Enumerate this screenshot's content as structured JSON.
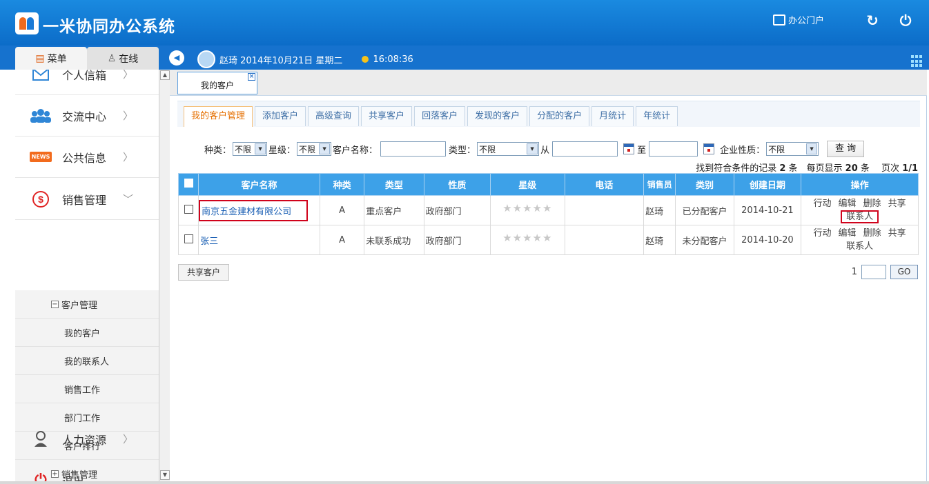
{
  "app": {
    "title": "一米协同办公系统",
    "portal": "办公门户"
  },
  "sidebar_tabs": {
    "menu": "菜单",
    "online": "在线"
  },
  "user": {
    "info": "赵琦 2014年10月21日 星期二",
    "time": "16:08:36"
  },
  "menu": [
    {
      "label": "个人信箱",
      "icon": "mail-icon"
    },
    {
      "label": "交流中心",
      "icon": "people-icon"
    },
    {
      "label": "公共信息",
      "icon": "news-icon",
      "badge": "NEWS"
    },
    {
      "label": "销售管理",
      "icon": "dollar-icon"
    },
    {
      "label": "人力资源",
      "icon": "person-icon"
    },
    {
      "label": "退出",
      "icon": "power-icon"
    }
  ],
  "submenu": {
    "group": "客户管理",
    "items": [
      "我的客户",
      "我的联系人",
      "销售工作",
      "部门工作",
      "客户排行"
    ],
    "group2": "销售管理"
  },
  "doc_tab": "我的客户",
  "subtabs": [
    "我的客户管理",
    "添加客户",
    "高级查询",
    "共享客户",
    "回落客户",
    "发现的客户",
    "分配的客户",
    "月统计",
    "年统计"
  ],
  "search": {
    "kind_label": "种类：",
    "kind": "不限",
    "star_label": "星级：",
    "star": "不限",
    "name_label": "客户名称：",
    "type_label": "类型：",
    "type": "不限",
    "from_label": "从",
    "to_label": "至",
    "nature_label": "企业性质：",
    "nature": "不限",
    "button": "查 询"
  },
  "summary": {
    "pre": "找到符合条件的记录 ",
    "count": "2",
    "mid": " 条　每页显示 ",
    "per": "20",
    "mid2": " 条　 页次 ",
    "page": "1/1"
  },
  "table": {
    "headers": [
      "客户名称",
      "种类",
      "类型",
      "性质",
      "星级",
      "电话",
      "销售员",
      "类别",
      "创建日期",
      "操作"
    ],
    "rows": [
      {
        "name": "南京五金建材有限公司",
        "kind": "A",
        "type": "重点客户",
        "nature": "政府部门",
        "stars": 0,
        "phone": "",
        "sales": "赵琦",
        "category": "已分配客户",
        "date": "2014-10-21"
      },
      {
        "name": "张三",
        "kind": "A",
        "type": "未联系成功",
        "nature": "政府部门",
        "stars": 0,
        "phone": "",
        "sales": "赵琦",
        "category": "未分配客户",
        "date": "2014-10-20"
      }
    ],
    "ops": {
      "action": "行动",
      "edit": "编辑",
      "delete": "删除",
      "share": "共享",
      "contact": "联系人"
    }
  },
  "share_button": "共享客户",
  "pager": {
    "page": "1",
    "go": "GO"
  }
}
